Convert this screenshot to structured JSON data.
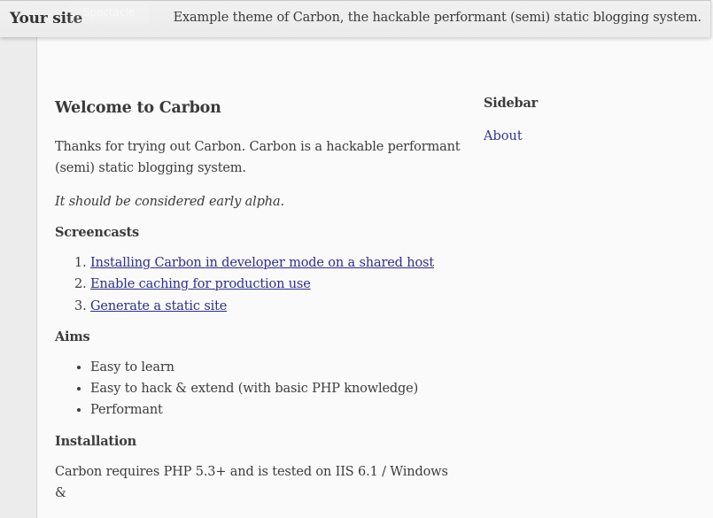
{
  "header": {
    "site_title": "Your site",
    "tagline": "Example theme of Carbon, the hackable performant (semi) static blogging system.",
    "overlay_label": "Spectacle"
  },
  "article": {
    "title": "Welcome to Carbon",
    "intro": "Thanks for trying out Carbon. Carbon is a hackable performant (semi) static blogging system.",
    "note": "It should be considered early alpha.",
    "screencasts": {
      "heading": "Screencasts",
      "items": [
        {
          "label": "Installing Carbon in developer mode on a shared host"
        },
        {
          "label": "Enable caching for production use"
        },
        {
          "label": "Generate a static site"
        }
      ]
    },
    "aims": {
      "heading": "Aims",
      "items": [
        {
          "label": "Easy to learn"
        },
        {
          "label": "Easy to hack & extend (with basic PHP knowledge)"
        },
        {
          "label": "Performant"
        }
      ]
    },
    "installation": {
      "heading": "Installation",
      "text": "Carbon requires PHP 5.3+ and is tested on IIS 6.1 / Windows &"
    }
  },
  "sidebar": {
    "heading": "Sidebar",
    "links": [
      {
        "label": "About"
      }
    ]
  },
  "colors": {
    "link": "#2e2e8c",
    "text": "#3c3c3c",
    "header_bg": "#eeeeee",
    "page_bg": "#fafafa"
  }
}
